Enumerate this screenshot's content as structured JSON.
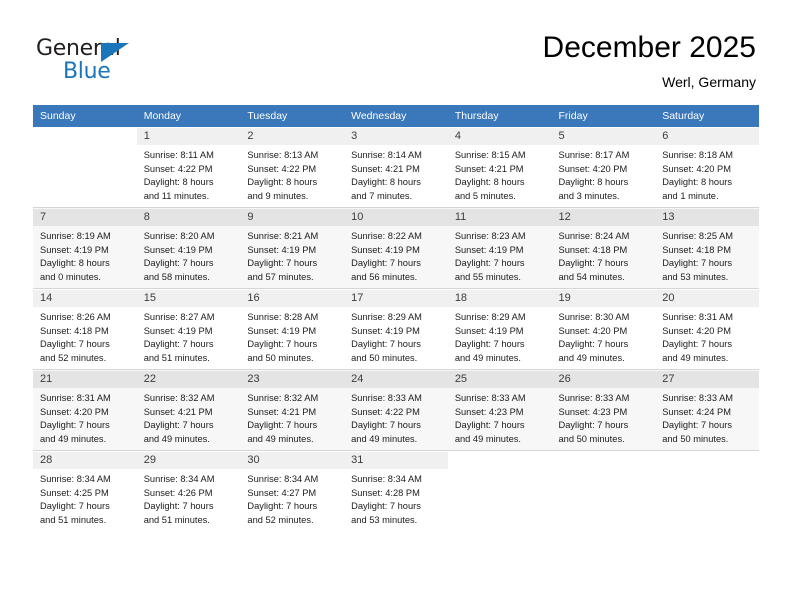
{
  "brand": {
    "name_top": "General",
    "name_bottom": "Blue",
    "accent_color": "#1b75bb",
    "triangle_icon": "triangle-icon"
  },
  "header": {
    "month_title": "December 2025",
    "location": "Werl, Germany"
  },
  "calendar": {
    "header_background": "#3a77bb",
    "header_text_color": "#ffffff",
    "weekday_headers": [
      "Sunday",
      "Monday",
      "Tuesday",
      "Wednesday",
      "Thursday",
      "Friday",
      "Saturday"
    ],
    "weeks": [
      [
        {
          "day": "",
          "sunrise": "",
          "sunset": "",
          "daylight_line1": "",
          "daylight_line2": ""
        },
        {
          "day": "1",
          "sunrise": "Sunrise: 8:11 AM",
          "sunset": "Sunset: 4:22 PM",
          "daylight_line1": "Daylight: 8 hours",
          "daylight_line2": "and 11 minutes."
        },
        {
          "day": "2",
          "sunrise": "Sunrise: 8:13 AM",
          "sunset": "Sunset: 4:22 PM",
          "daylight_line1": "Daylight: 8 hours",
          "daylight_line2": "and 9 minutes."
        },
        {
          "day": "3",
          "sunrise": "Sunrise: 8:14 AM",
          "sunset": "Sunset: 4:21 PM",
          "daylight_line1": "Daylight: 8 hours",
          "daylight_line2": "and 7 minutes."
        },
        {
          "day": "4",
          "sunrise": "Sunrise: 8:15 AM",
          "sunset": "Sunset: 4:21 PM",
          "daylight_line1": "Daylight: 8 hours",
          "daylight_line2": "and 5 minutes."
        },
        {
          "day": "5",
          "sunrise": "Sunrise: 8:17 AM",
          "sunset": "Sunset: 4:20 PM",
          "daylight_line1": "Daylight: 8 hours",
          "daylight_line2": "and 3 minutes."
        },
        {
          "day": "6",
          "sunrise": "Sunrise: 8:18 AM",
          "sunset": "Sunset: 4:20 PM",
          "daylight_line1": "Daylight: 8 hours",
          "daylight_line2": "and 1 minute."
        }
      ],
      [
        {
          "day": "7",
          "sunrise": "Sunrise: 8:19 AM",
          "sunset": "Sunset: 4:19 PM",
          "daylight_line1": "Daylight: 8 hours",
          "daylight_line2": "and 0 minutes."
        },
        {
          "day": "8",
          "sunrise": "Sunrise: 8:20 AM",
          "sunset": "Sunset: 4:19 PM",
          "daylight_line1": "Daylight: 7 hours",
          "daylight_line2": "and 58 minutes."
        },
        {
          "day": "9",
          "sunrise": "Sunrise: 8:21 AM",
          "sunset": "Sunset: 4:19 PM",
          "daylight_line1": "Daylight: 7 hours",
          "daylight_line2": "and 57 minutes."
        },
        {
          "day": "10",
          "sunrise": "Sunrise: 8:22 AM",
          "sunset": "Sunset: 4:19 PM",
          "daylight_line1": "Daylight: 7 hours",
          "daylight_line2": "and 56 minutes."
        },
        {
          "day": "11",
          "sunrise": "Sunrise: 8:23 AM",
          "sunset": "Sunset: 4:19 PM",
          "daylight_line1": "Daylight: 7 hours",
          "daylight_line2": "and 55 minutes."
        },
        {
          "day": "12",
          "sunrise": "Sunrise: 8:24 AM",
          "sunset": "Sunset: 4:18 PM",
          "daylight_line1": "Daylight: 7 hours",
          "daylight_line2": "and 54 minutes."
        },
        {
          "day": "13",
          "sunrise": "Sunrise: 8:25 AM",
          "sunset": "Sunset: 4:18 PM",
          "daylight_line1": "Daylight: 7 hours",
          "daylight_line2": "and 53 minutes."
        }
      ],
      [
        {
          "day": "14",
          "sunrise": "Sunrise: 8:26 AM",
          "sunset": "Sunset: 4:18 PM",
          "daylight_line1": "Daylight: 7 hours",
          "daylight_line2": "and 52 minutes."
        },
        {
          "day": "15",
          "sunrise": "Sunrise: 8:27 AM",
          "sunset": "Sunset: 4:19 PM",
          "daylight_line1": "Daylight: 7 hours",
          "daylight_line2": "and 51 minutes."
        },
        {
          "day": "16",
          "sunrise": "Sunrise: 8:28 AM",
          "sunset": "Sunset: 4:19 PM",
          "daylight_line1": "Daylight: 7 hours",
          "daylight_line2": "and 50 minutes."
        },
        {
          "day": "17",
          "sunrise": "Sunrise: 8:29 AM",
          "sunset": "Sunset: 4:19 PM",
          "daylight_line1": "Daylight: 7 hours",
          "daylight_line2": "and 50 minutes."
        },
        {
          "day": "18",
          "sunrise": "Sunrise: 8:29 AM",
          "sunset": "Sunset: 4:19 PM",
          "daylight_line1": "Daylight: 7 hours",
          "daylight_line2": "and 49 minutes."
        },
        {
          "day": "19",
          "sunrise": "Sunrise: 8:30 AM",
          "sunset": "Sunset: 4:20 PM",
          "daylight_line1": "Daylight: 7 hours",
          "daylight_line2": "and 49 minutes."
        },
        {
          "day": "20",
          "sunrise": "Sunrise: 8:31 AM",
          "sunset": "Sunset: 4:20 PM",
          "daylight_line1": "Daylight: 7 hours",
          "daylight_line2": "and 49 minutes."
        }
      ],
      [
        {
          "day": "21",
          "sunrise": "Sunrise: 8:31 AM",
          "sunset": "Sunset: 4:20 PM",
          "daylight_line1": "Daylight: 7 hours",
          "daylight_line2": "and 49 minutes."
        },
        {
          "day": "22",
          "sunrise": "Sunrise: 8:32 AM",
          "sunset": "Sunset: 4:21 PM",
          "daylight_line1": "Daylight: 7 hours",
          "daylight_line2": "and 49 minutes."
        },
        {
          "day": "23",
          "sunrise": "Sunrise: 8:32 AM",
          "sunset": "Sunset: 4:21 PM",
          "daylight_line1": "Daylight: 7 hours",
          "daylight_line2": "and 49 minutes."
        },
        {
          "day": "24",
          "sunrise": "Sunrise: 8:33 AM",
          "sunset": "Sunset: 4:22 PM",
          "daylight_line1": "Daylight: 7 hours",
          "daylight_line2": "and 49 minutes."
        },
        {
          "day": "25",
          "sunrise": "Sunrise: 8:33 AM",
          "sunset": "Sunset: 4:23 PM",
          "daylight_line1": "Daylight: 7 hours",
          "daylight_line2": "and 49 minutes."
        },
        {
          "day": "26",
          "sunrise": "Sunrise: 8:33 AM",
          "sunset": "Sunset: 4:23 PM",
          "daylight_line1": "Daylight: 7 hours",
          "daylight_line2": "and 50 minutes."
        },
        {
          "day": "27",
          "sunrise": "Sunrise: 8:33 AM",
          "sunset": "Sunset: 4:24 PM",
          "daylight_line1": "Daylight: 7 hours",
          "daylight_line2": "and 50 minutes."
        }
      ],
      [
        {
          "day": "28",
          "sunrise": "Sunrise: 8:34 AM",
          "sunset": "Sunset: 4:25 PM",
          "daylight_line1": "Daylight: 7 hours",
          "daylight_line2": "and 51 minutes."
        },
        {
          "day": "29",
          "sunrise": "Sunrise: 8:34 AM",
          "sunset": "Sunset: 4:26 PM",
          "daylight_line1": "Daylight: 7 hours",
          "daylight_line2": "and 51 minutes."
        },
        {
          "day": "30",
          "sunrise": "Sunrise: 8:34 AM",
          "sunset": "Sunset: 4:27 PM",
          "daylight_line1": "Daylight: 7 hours",
          "daylight_line2": "and 52 minutes."
        },
        {
          "day": "31",
          "sunrise": "Sunrise: 8:34 AM",
          "sunset": "Sunset: 4:28 PM",
          "daylight_line1": "Daylight: 7 hours",
          "daylight_line2": "and 53 minutes."
        },
        {
          "day": "",
          "sunrise": "",
          "sunset": "",
          "daylight_line1": "",
          "daylight_line2": ""
        },
        {
          "day": "",
          "sunrise": "",
          "sunset": "",
          "daylight_line1": "",
          "daylight_line2": ""
        },
        {
          "day": "",
          "sunrise": "",
          "sunset": "",
          "daylight_line1": "",
          "daylight_line2": ""
        }
      ]
    ]
  }
}
